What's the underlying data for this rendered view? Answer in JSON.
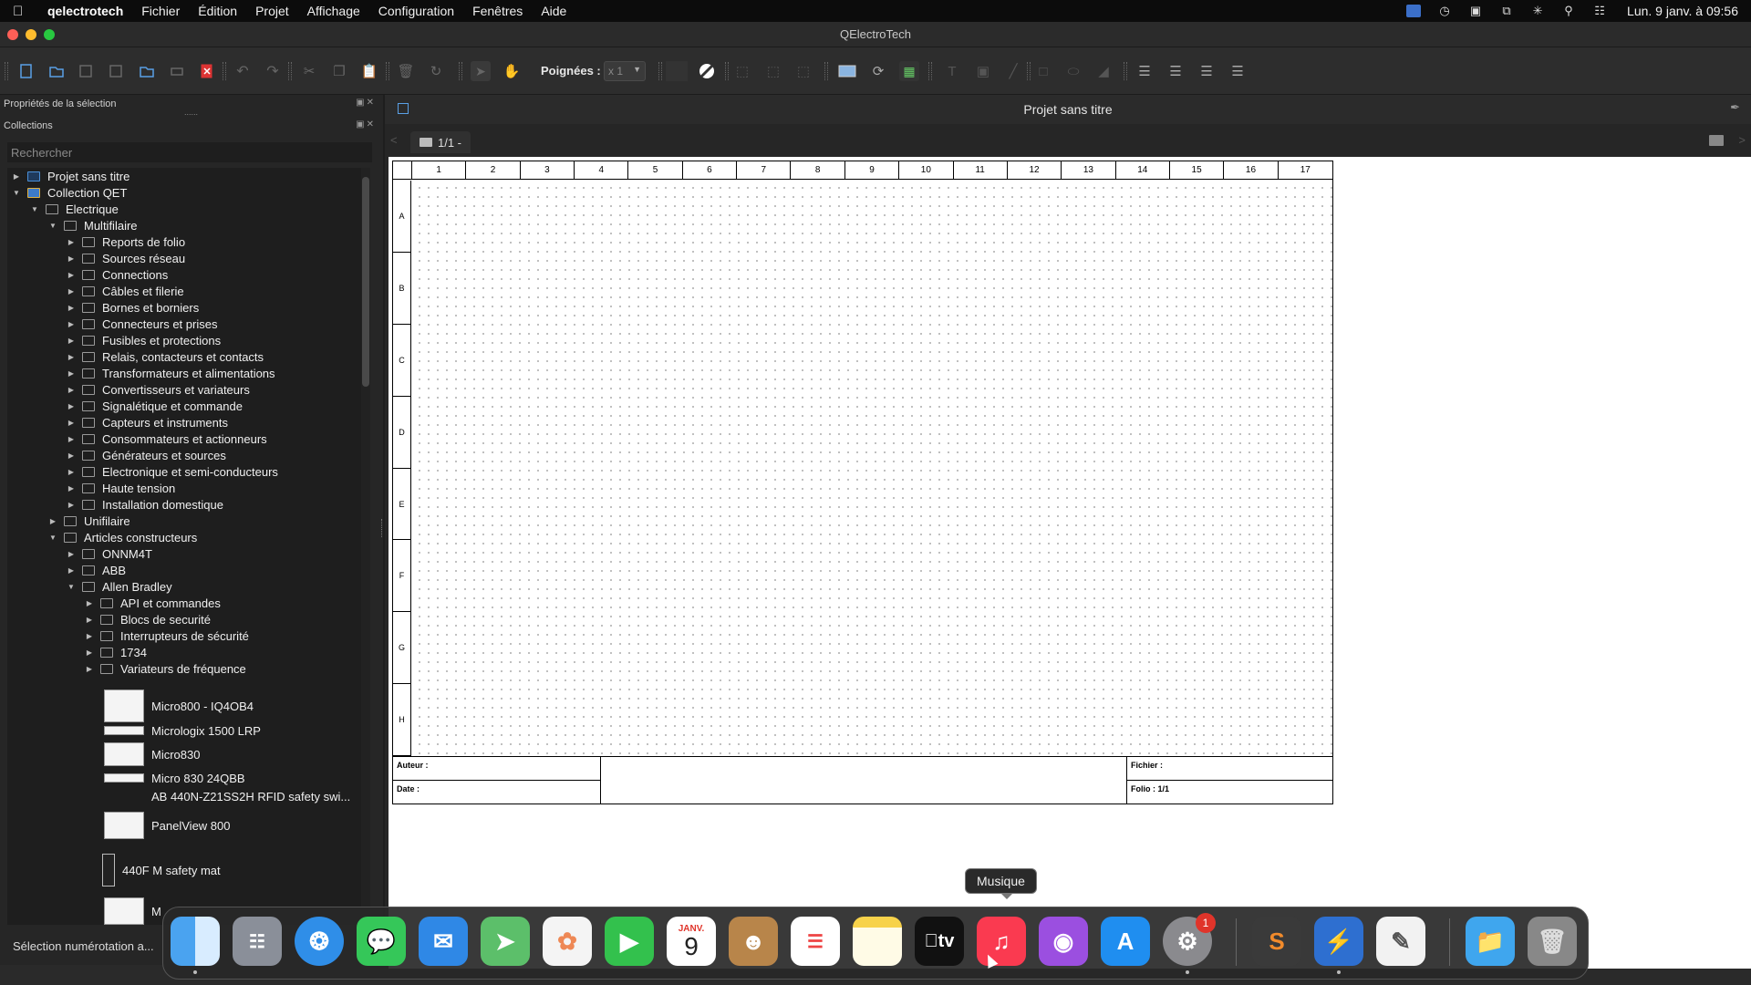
{
  "menubar": {
    "app_name": "qelectrotech",
    "items": [
      "Fichier",
      "Édition",
      "Projet",
      "Affichage",
      "Configuration",
      "Fenêtres",
      "Aide"
    ],
    "clock": "Lun. 9 janv. à 09:56"
  },
  "window": {
    "title": "QElectroTech"
  },
  "toolbar": {
    "poignees_label": "Poignées :",
    "poignees_value": "x 1"
  },
  "left_dock": {
    "properties_title": "Propriétés de la sélection",
    "collections_title": "Collections",
    "search_placeholder": "Rechercher",
    "tree": [
      {
        "label": "Projet sans titre",
        "depth": 0,
        "expanded": false,
        "icon": "project-icon"
      },
      {
        "label": "Collection QET",
        "depth": 0,
        "expanded": true,
        "icon": "qet-collection-icon"
      },
      {
        "label": "Electrique",
        "depth": 1,
        "expanded": true,
        "icon": "folder-icon"
      },
      {
        "label": "Multifilaire",
        "depth": 2,
        "expanded": true,
        "icon": "folder-icon"
      },
      {
        "label": "Reports de folio",
        "depth": 3,
        "expanded": false,
        "icon": "folder-icon"
      },
      {
        "label": "Sources réseau",
        "depth": 3,
        "expanded": false,
        "icon": "folder-icon"
      },
      {
        "label": "Connections",
        "depth": 3,
        "expanded": false,
        "icon": "folder-icon"
      },
      {
        "label": "Câbles et filerie",
        "depth": 3,
        "expanded": false,
        "icon": "folder-icon"
      },
      {
        "label": "Bornes et borniers",
        "depth": 3,
        "expanded": false,
        "icon": "folder-icon"
      },
      {
        "label": "Connecteurs et prises",
        "depth": 3,
        "expanded": false,
        "icon": "folder-icon"
      },
      {
        "label": "Fusibles et protections",
        "depth": 3,
        "expanded": false,
        "icon": "folder-icon"
      },
      {
        "label": "Relais, contacteurs et contacts",
        "depth": 3,
        "expanded": false,
        "icon": "folder-icon"
      },
      {
        "label": "Transformateurs et alimentations",
        "depth": 3,
        "expanded": false,
        "icon": "folder-icon"
      },
      {
        "label": "Convertisseurs et variateurs",
        "depth": 3,
        "expanded": false,
        "icon": "folder-icon"
      },
      {
        "label": "Signalétique et commande",
        "depth": 3,
        "expanded": false,
        "icon": "folder-icon"
      },
      {
        "label": "Capteurs et instruments",
        "depth": 3,
        "expanded": false,
        "icon": "folder-icon"
      },
      {
        "label": "Consommateurs et actionneurs",
        "depth": 3,
        "expanded": false,
        "icon": "folder-icon"
      },
      {
        "label": "Générateurs et sources",
        "depth": 3,
        "expanded": false,
        "icon": "folder-icon"
      },
      {
        "label": "Electronique et semi-conducteurs",
        "depth": 3,
        "expanded": false,
        "icon": "folder-icon"
      },
      {
        "label": "Haute tension",
        "depth": 3,
        "expanded": false,
        "icon": "folder-icon"
      },
      {
        "label": "Installation domestique",
        "depth": 3,
        "expanded": false,
        "icon": "folder-icon"
      },
      {
        "label": "Unifilaire",
        "depth": 2,
        "expanded": false,
        "icon": "folder-icon"
      },
      {
        "label": "Articles constructeurs",
        "depth": 2,
        "expanded": true,
        "icon": "folder-icon"
      },
      {
        "label": "ONNM4T",
        "depth": 3,
        "expanded": false,
        "icon": "folder-icon"
      },
      {
        "label": "ABB",
        "depth": 3,
        "expanded": false,
        "icon": "folder-icon"
      },
      {
        "label": "Allen Bradley",
        "depth": 3,
        "expanded": true,
        "icon": "folder-icon"
      },
      {
        "label": "API et commandes",
        "depth": 4,
        "expanded": false,
        "icon": "folder-icon"
      },
      {
        "label": "Blocs de securité",
        "depth": 4,
        "expanded": false,
        "icon": "folder-icon"
      },
      {
        "label": "Interrupteurs de sécurité",
        "depth": 4,
        "expanded": false,
        "icon": "folder-icon"
      },
      {
        "label": "1734",
        "depth": 4,
        "expanded": false,
        "icon": "folder-icon"
      },
      {
        "label": "Variateurs de fréquence",
        "depth": 4,
        "expanded": false,
        "icon": "folder-icon"
      }
    ],
    "elements": [
      {
        "label": "Micro800 -  IQ4OB4"
      },
      {
        "label": "Micrologix 1500 LRP"
      },
      {
        "label": "Micro830"
      },
      {
        "label": "Micro 830 24QBB"
      },
      {
        "label": "AB 440N-Z21SS2H RFID safety swi..."
      },
      {
        "label": "PanelView 800"
      },
      {
        "label": "440F M safety mat"
      },
      {
        "label": "M"
      }
    ],
    "status": "Sélection numérotation a..."
  },
  "main": {
    "project_title": "Projet sans titre",
    "folio_tab": "1/1 -",
    "columns": [
      "1",
      "2",
      "3",
      "4",
      "5",
      "6",
      "7",
      "8",
      "9",
      "10",
      "11",
      "12",
      "13",
      "14",
      "15",
      "16",
      "17"
    ],
    "rows": [
      "A",
      "B",
      "C",
      "D",
      "E",
      "F",
      "G",
      "H"
    ],
    "cartouche": {
      "auteur": "Auteur :",
      "date": "Date :",
      "fichier": "Fichier :",
      "folio": "Folio : 1/1"
    }
  },
  "dock": {
    "tooltip": "Musique",
    "calendar_month": "JANV.",
    "calendar_day": "9",
    "tv_label": "tv",
    "settings_badge": "1"
  }
}
